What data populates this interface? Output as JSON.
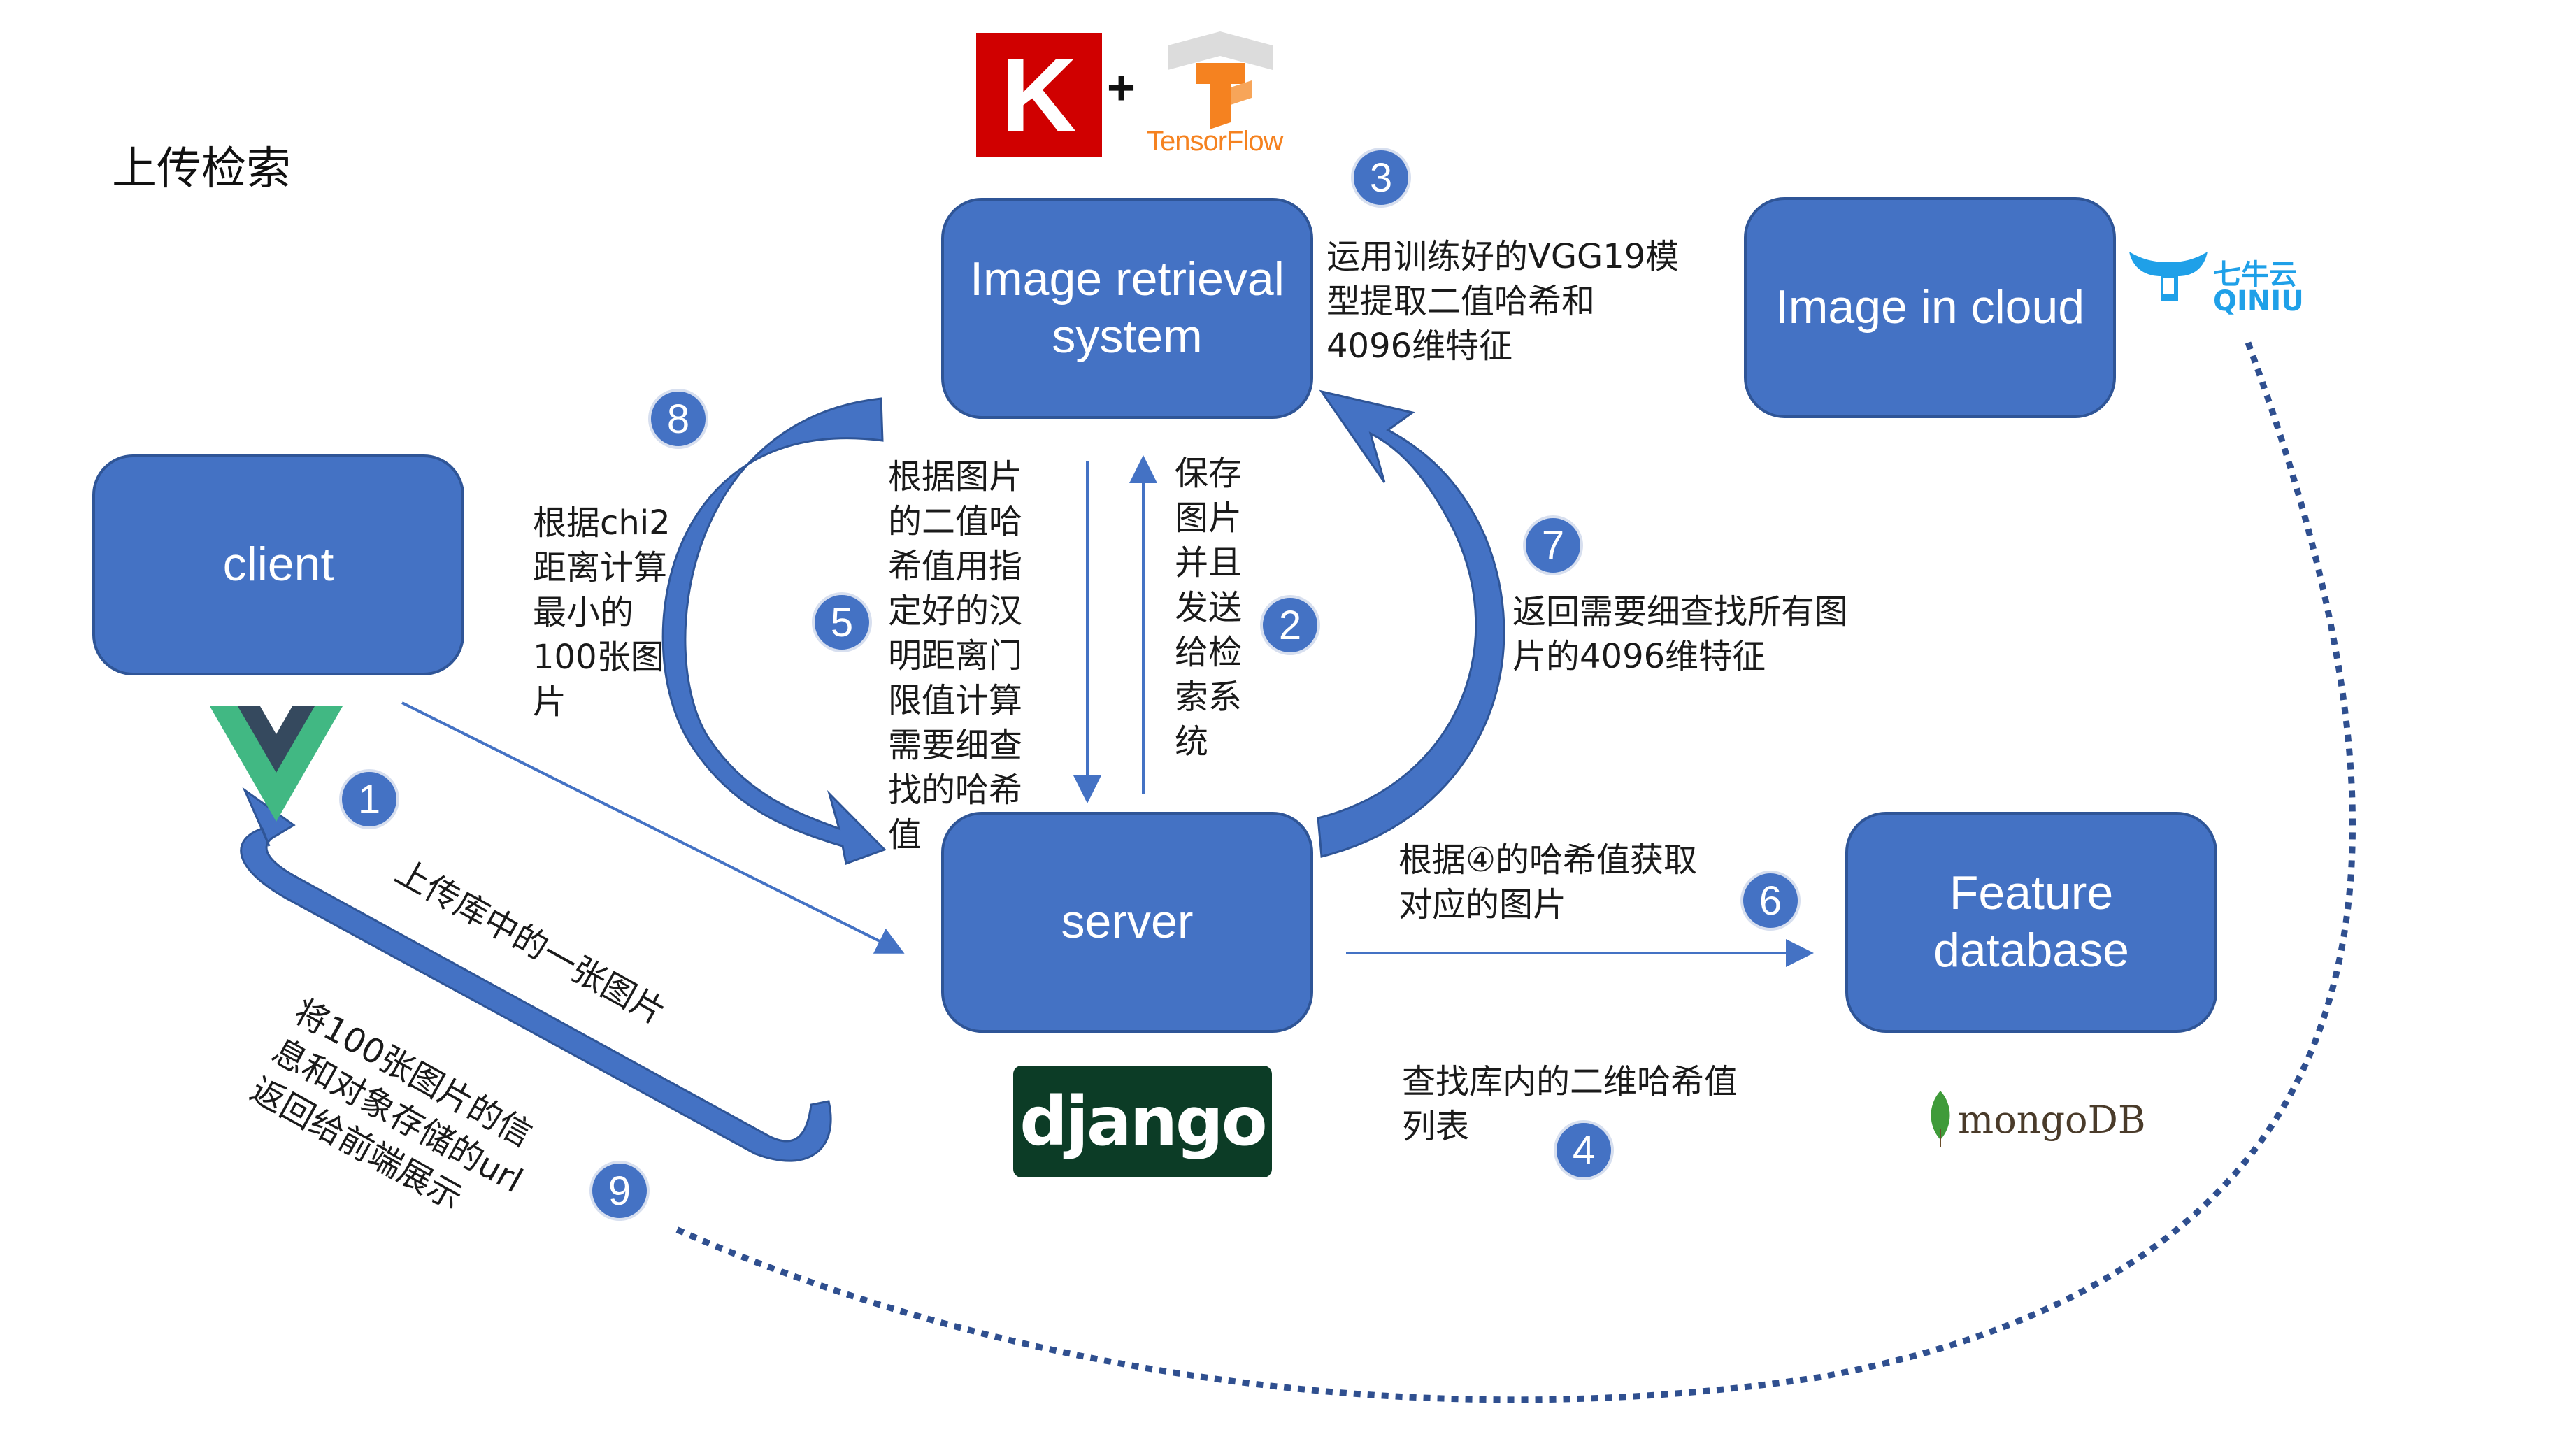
{
  "title": "上传检索",
  "nodes": {
    "image_retrieval": "Image retrieval system",
    "image_cloud": "Image in cloud",
    "client": "client",
    "server": "server",
    "feature_db": "Feature database"
  },
  "steps": [
    {
      "num": "1",
      "text": "上传库中的一张图片"
    },
    {
      "num": "2",
      "text": "保存\n图片\n并且\n发送\n给检\n索系\n统"
    },
    {
      "num": "3",
      "text": "运用训练好的VGG19模\n型提取二值哈希和\n4096维特征"
    },
    {
      "num": "4",
      "text": "查找库内的二维哈希值\n列表"
    },
    {
      "num": "5",
      "text": "根据图片\n的二值哈\n希值用指\n定好的汉\n明距离门\n限值计算\n需要细查\n找的哈希\n值"
    },
    {
      "num": "6",
      "text": "根据④的哈希值获取\n对应的图片"
    },
    {
      "num": "7",
      "text": "返回需要细查找所有图\n片的4096维特征"
    },
    {
      "num": "8",
      "text": "根据chi2\n距离计算\n最小的\n100张图\n片"
    },
    {
      "num": "9",
      "text": "将100张图片的信\n息和对象存储的url\n返回给前端展示"
    }
  ],
  "logos": {
    "keras": "K",
    "plus": "+",
    "tensorflow": "TensorFlow",
    "qiniu_cn": "七牛云",
    "qiniu_en": "QINIU",
    "django": "django",
    "mongodb": "mongoDB",
    "vue": "vue"
  },
  "colors": {
    "box_fill": "#4472c4",
    "box_border": "#2f5597",
    "arrow": "#4472c4",
    "dotted": "#2f4f8f",
    "keras_red": "#d00000",
    "tf_orange": "#f58220",
    "django_green": "#0c3c26",
    "mongo_leaf": "#3f9b3a",
    "vue_green": "#41b883",
    "vue_dark": "#35495e"
  }
}
